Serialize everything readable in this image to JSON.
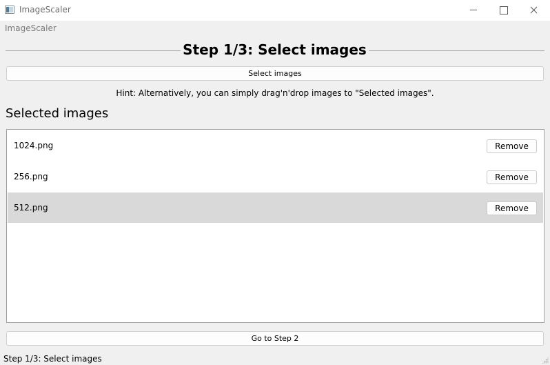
{
  "window": {
    "title": "ImageScaler"
  },
  "menu": {
    "title": "ImageScaler"
  },
  "step": {
    "heading": "Step 1/3: Select images"
  },
  "buttons": {
    "select_images": "Select images",
    "go_to_step": "Go to Step 2",
    "remove": "Remove"
  },
  "hint": "Hint: Alternatively, you can simply drag'n'drop images to \"Selected images\".",
  "selected_section": {
    "title": "Selected images",
    "items": [
      {
        "name": "1024.png",
        "selected": false
      },
      {
        "name": "256.png",
        "selected": false
      },
      {
        "name": "512.png",
        "selected": true
      }
    ]
  },
  "status": {
    "text": "Step 1/3: Select images"
  },
  "colors": {
    "background": "#f0f0f0",
    "list_background": "#ffffff",
    "selected_row": "#d9d9d9",
    "button_face": "#fdfdfd"
  }
}
